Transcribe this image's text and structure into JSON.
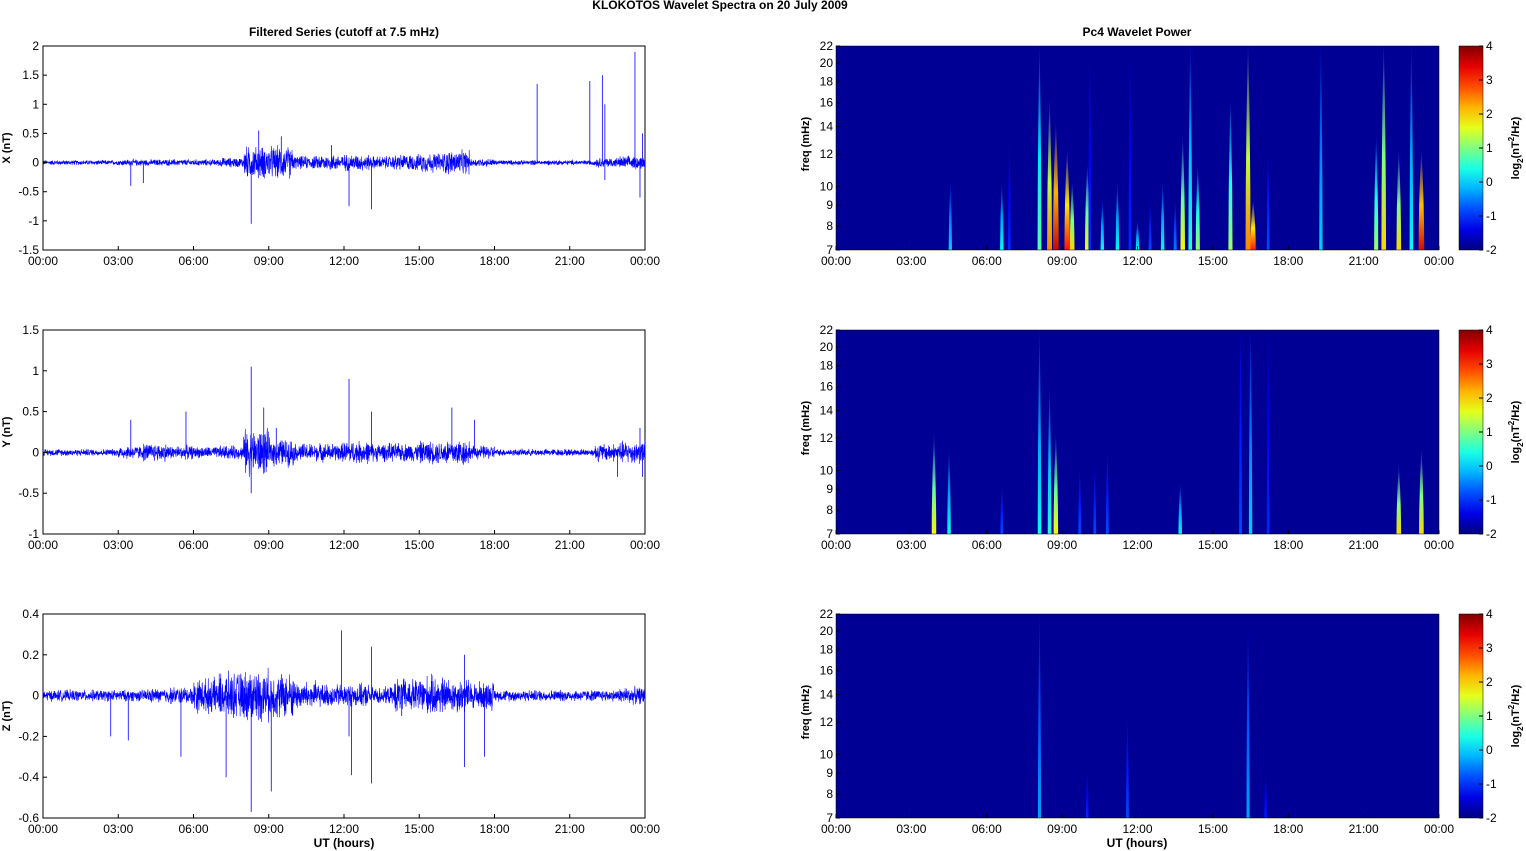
{
  "title": "KLOKOTOS Wavelet Spectra on 20 July      2009",
  "left_title": "Filtered Series (cutoff at 7.5 mHz)",
  "right_title": "Pc4 Wavelet Power",
  "xlabel": "UT (hours)",
  "time_ticks": [
    "00:00",
    "03:00",
    "06:00",
    "09:00",
    "12:00",
    "15:00",
    "18:00",
    "21:00",
    "00:00"
  ],
  "chart_data": [
    {
      "type": "line",
      "name": "X",
      "ylabel": "X (nT)",
      "xlim": [
        0,
        24
      ],
      "ylim": [
        -1.5,
        2
      ],
      "yticks": [
        -1.5,
        -1,
        -0.5,
        0,
        0.5,
        1,
        1.5,
        2
      ],
      "ytick_labels": [
        "-1.5",
        "-1",
        "-0.5",
        "0",
        "0.5",
        "1",
        "1.5",
        "2"
      ],
      "color": "#0000ff",
      "noise_envelope_hourly": [
        0.03,
        0.03,
        0.03,
        0.04,
        0.04,
        0.04,
        0.04,
        0.06,
        0.2,
        0.2,
        0.08,
        0.1,
        0.1,
        0.08,
        0.1,
        0.12,
        0.15,
        0.05,
        0.03,
        0.03,
        0.03,
        0.03,
        0.06,
        0.08
      ],
      "spikes": [
        [
          3.5,
          -0.4
        ],
        [
          4.0,
          -0.35
        ],
        [
          8.3,
          -1.05
        ],
        [
          8.6,
          0.55
        ],
        [
          9.5,
          0.45
        ],
        [
          11.5,
          0.3
        ],
        [
          12.2,
          -0.75
        ],
        [
          13.1,
          -0.8
        ],
        [
          19.7,
          1.35
        ],
        [
          21.8,
          1.4
        ],
        [
          22.3,
          1.5
        ],
        [
          22.4,
          1.0
        ],
        [
          22.4,
          -0.3
        ],
        [
          23.6,
          1.9
        ],
        [
          23.8,
          -0.6
        ],
        [
          23.9,
          0.5
        ]
      ]
    },
    {
      "type": "line",
      "name": "Y",
      "ylabel": "Y (nT)",
      "xlim": [
        0,
        24
      ],
      "ylim": [
        -1,
        1.5
      ],
      "yticks": [
        -1,
        -0.5,
        0,
        0.5,
        1,
        1.5
      ],
      "ytick_labels": [
        "-1",
        "-0.5",
        "0",
        "0.5",
        "1",
        "1.5"
      ],
      "color": "#0000ff",
      "noise_envelope_hourly": [
        0.03,
        0.03,
        0.03,
        0.06,
        0.08,
        0.06,
        0.05,
        0.06,
        0.2,
        0.12,
        0.08,
        0.08,
        0.1,
        0.08,
        0.08,
        0.1,
        0.12,
        0.06,
        0.03,
        0.03,
        0.03,
        0.03,
        0.08,
        0.1
      ],
      "spikes": [
        [
          3.5,
          0.4
        ],
        [
          5.7,
          0.5
        ],
        [
          8.3,
          1.05
        ],
        [
          8.3,
          -0.5
        ],
        [
          8.8,
          0.55
        ],
        [
          9.3,
          0.3
        ],
        [
          12.2,
          0.9
        ],
        [
          13.1,
          0.5
        ],
        [
          16.3,
          0.55
        ],
        [
          17.2,
          0.4
        ],
        [
          22.9,
          -0.3
        ],
        [
          23.8,
          0.3
        ],
        [
          23.9,
          -0.3
        ]
      ]
    },
    {
      "type": "line",
      "name": "Z",
      "ylabel": "Z (nT)",
      "xlim": [
        0,
        24
      ],
      "ylim": [
        -0.6,
        0.4
      ],
      "yticks": [
        -0.6,
        -0.4,
        -0.2,
        0,
        0.2,
        0.4
      ],
      "ytick_labels": [
        "-0.6",
        "-0.4",
        "-0.2",
        "0",
        "0.2",
        "0.4"
      ],
      "color": "#0000ff",
      "noise_envelope_hourly": [
        0.02,
        0.02,
        0.02,
        0.02,
        0.025,
        0.03,
        0.06,
        0.08,
        0.09,
        0.08,
        0.05,
        0.04,
        0.04,
        0.03,
        0.06,
        0.07,
        0.06,
        0.05,
        0.02,
        0.02,
        0.02,
        0.02,
        0.02,
        0.03
      ],
      "spikes": [
        [
          2.7,
          -0.2
        ],
        [
          3.4,
          -0.22
        ],
        [
          5.5,
          -0.3
        ],
        [
          7.3,
          -0.4
        ],
        [
          8.3,
          -0.57
        ],
        [
          9.1,
          -0.47
        ],
        [
          11.9,
          0.32
        ],
        [
          12.2,
          -0.2
        ],
        [
          12.3,
          -0.39
        ],
        [
          13.1,
          0.24
        ],
        [
          13.1,
          -0.43
        ],
        [
          14.3,
          -0.1
        ],
        [
          16.8,
          0.2
        ],
        [
          16.8,
          -0.35
        ],
        [
          17.6,
          -0.3
        ]
      ]
    },
    {
      "type": "heatmap",
      "name": "X power",
      "ylabel": "freq (mHz)",
      "ylim": [
        7,
        22
      ],
      "yscale": "log",
      "yticks": [
        7,
        8,
        9,
        10,
        12,
        14,
        16,
        18,
        20,
        22
      ],
      "ytick_labels": [
        "7",
        "8",
        "9",
        "10",
        "12",
        "14",
        "16",
        "18",
        "20",
        "22"
      ],
      "clim": [
        -2,
        4
      ],
      "colorbar_label": "log2(nT^2/Hz)",
      "colorbar_ticks": [
        "-2",
        "-1",
        "0",
        "1",
        "2",
        "3",
        "4"
      ],
      "events": [
        [
          4.55,
          10,
          0
        ],
        [
          6.6,
          10,
          0.3
        ],
        [
          6.9,
          13,
          -1
        ],
        [
          8.1,
          22,
          0.8
        ],
        [
          8.5,
          16,
          2.5
        ],
        [
          8.75,
          14,
          3.6
        ],
        [
          9.2,
          12,
          3.2
        ],
        [
          9.4,
          10,
          2
        ],
        [
          10.0,
          11,
          1.8
        ],
        [
          10.1,
          22,
          -1
        ],
        [
          10.6,
          9,
          0.3
        ],
        [
          11.2,
          10,
          0.3
        ],
        [
          11.7,
          22,
          -1
        ],
        [
          12.0,
          8,
          0.3
        ],
        [
          12.5,
          9,
          -0.8
        ],
        [
          13.0,
          10,
          0.3
        ],
        [
          13.5,
          9,
          -0.5
        ],
        [
          13.8,
          13,
          1.8
        ],
        [
          14.1,
          22,
          0.5
        ],
        [
          14.4,
          11,
          1.2
        ],
        [
          15.7,
          16,
          1.2
        ],
        [
          16.4,
          22,
          2.5
        ],
        [
          16.6,
          9,
          3.2
        ],
        [
          17.2,
          12,
          -0.8
        ],
        [
          19.3,
          22,
          0
        ],
        [
          21.5,
          13,
          1.2
        ],
        [
          21.8,
          22,
          2
        ],
        [
          22.4,
          12,
          2
        ],
        [
          22.9,
          22,
          0.3
        ],
        [
          23.3,
          12,
          3.5
        ]
      ]
    },
    {
      "type": "heatmap",
      "name": "Y power",
      "ylabel": "freq (mHz)",
      "ylim": [
        7,
        22
      ],
      "yscale": "log",
      "yticks": [
        7,
        8,
        9,
        10,
        12,
        14,
        16,
        18,
        20,
        22
      ],
      "ytick_labels": [
        "7",
        "8",
        "9",
        "10",
        "12",
        "14",
        "16",
        "18",
        "20",
        "22"
      ],
      "clim": [
        -2,
        4
      ],
      "colorbar_label": "log2(nT^2/Hz)",
      "colorbar_ticks": [
        "-2",
        "-1",
        "0",
        "1",
        "2",
        "3",
        "4"
      ],
      "events": [
        [
          3.9,
          12,
          1.8
        ],
        [
          4.5,
          11,
          0.3
        ],
        [
          6.6,
          9,
          -0.8
        ],
        [
          8.1,
          22,
          0.3
        ],
        [
          8.5,
          16,
          0.5
        ],
        [
          8.75,
          12,
          1.8
        ],
        [
          9.7,
          10,
          -0.8
        ],
        [
          10.3,
          10,
          -0.8
        ],
        [
          10.8,
          11,
          -0.8
        ],
        [
          13.7,
          9,
          0.3
        ],
        [
          16.1,
          22,
          -0.8
        ],
        [
          16.5,
          22,
          0
        ],
        [
          17.2,
          22,
          -1
        ],
        [
          22.4,
          10,
          2
        ],
        [
          23.3,
          11,
          2
        ]
      ]
    },
    {
      "type": "heatmap",
      "name": "Z power",
      "ylabel": "freq (mHz)",
      "ylim": [
        7,
        22
      ],
      "yscale": "log",
      "yticks": [
        7,
        8,
        9,
        10,
        12,
        14,
        16,
        18,
        20,
        22
      ],
      "ytick_labels": [
        "7",
        "8",
        "9",
        "10",
        "12",
        "14",
        "16",
        "18",
        "20",
        "22"
      ],
      "clim": [
        -2,
        4
      ],
      "colorbar_label": "log2(nT^2/Hz)",
      "colorbar_ticks": [
        "-2",
        "-1",
        "0",
        "1",
        "2",
        "3",
        "4"
      ],
      "events": [
        [
          8.1,
          22,
          -0.3
        ],
        [
          10.0,
          9,
          -1
        ],
        [
          11.6,
          12,
          -0.8
        ],
        [
          16.4,
          20,
          -0.3
        ],
        [
          17.1,
          9,
          -1.1
        ]
      ]
    }
  ]
}
